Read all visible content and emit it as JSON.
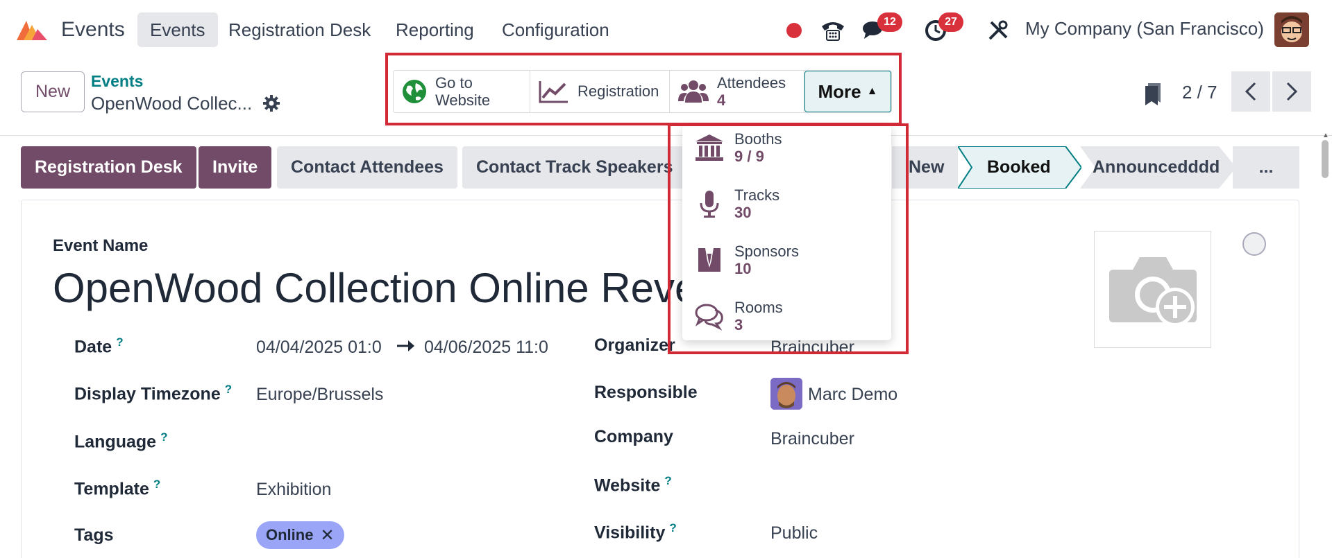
{
  "app": {
    "name": "Events"
  },
  "menu": [
    "Events",
    "Registration Desk",
    "Reporting",
    "Configuration"
  ],
  "system": {
    "messages_badge": "12",
    "activities_badge": "27",
    "company": "My Company (San Francisco)"
  },
  "control": {
    "new_label": "New",
    "breadcrumb_parent": "Events",
    "breadcrumb_current": "OpenWood Collec...",
    "pager": "2 / 7"
  },
  "smart_buttons": {
    "website_line1": "Go to",
    "website_line2": "Website",
    "registration": "Registration",
    "attendees_label": "Attendees",
    "attendees_count": "4",
    "more": "More"
  },
  "more_menu": [
    {
      "label": "Booths",
      "value": "9 / 9",
      "icon": "bank-icon"
    },
    {
      "label": "Tracks",
      "value": "30",
      "icon": "microphone-icon"
    },
    {
      "label": "Sponsors",
      "value": "10",
      "icon": "sponsor-flag-icon"
    },
    {
      "label": "Rooms",
      "value": "3",
      "icon": "chat-bubbles-icon"
    }
  ],
  "actions": [
    "Registration Desk",
    "Invite",
    "Contact Attendees",
    "Contact Track Speakers"
  ],
  "stages": [
    "New",
    "Booked",
    "Announcedddd",
    "..."
  ],
  "form": {
    "event_name_label": "Event Name",
    "event_name": "OpenWood Collection Online Reveal",
    "date_label": "Date",
    "date_start": "04/04/2025 01:0",
    "date_end": "04/06/2025 11:0",
    "tz_label": "Display Timezone",
    "tz_value": "Europe/Brussels",
    "language_label": "Language",
    "template_label": "Template",
    "template_value": "Exhibition",
    "tags_label": "Tags",
    "tag": "Online",
    "organizer_label": "Organizer",
    "organizer_value": "Braincuber",
    "responsible_label": "Responsible",
    "responsible_value": "Marc Demo",
    "company_label": "Company",
    "company_value": "Braincuber",
    "website_label": "Website",
    "visibility_label": "Visibility",
    "visibility_value": "Public",
    "help_mark": "?"
  },
  "colors": {
    "primary": "#714b67",
    "accent": "#017e84",
    "highlight": "#d12a36"
  }
}
